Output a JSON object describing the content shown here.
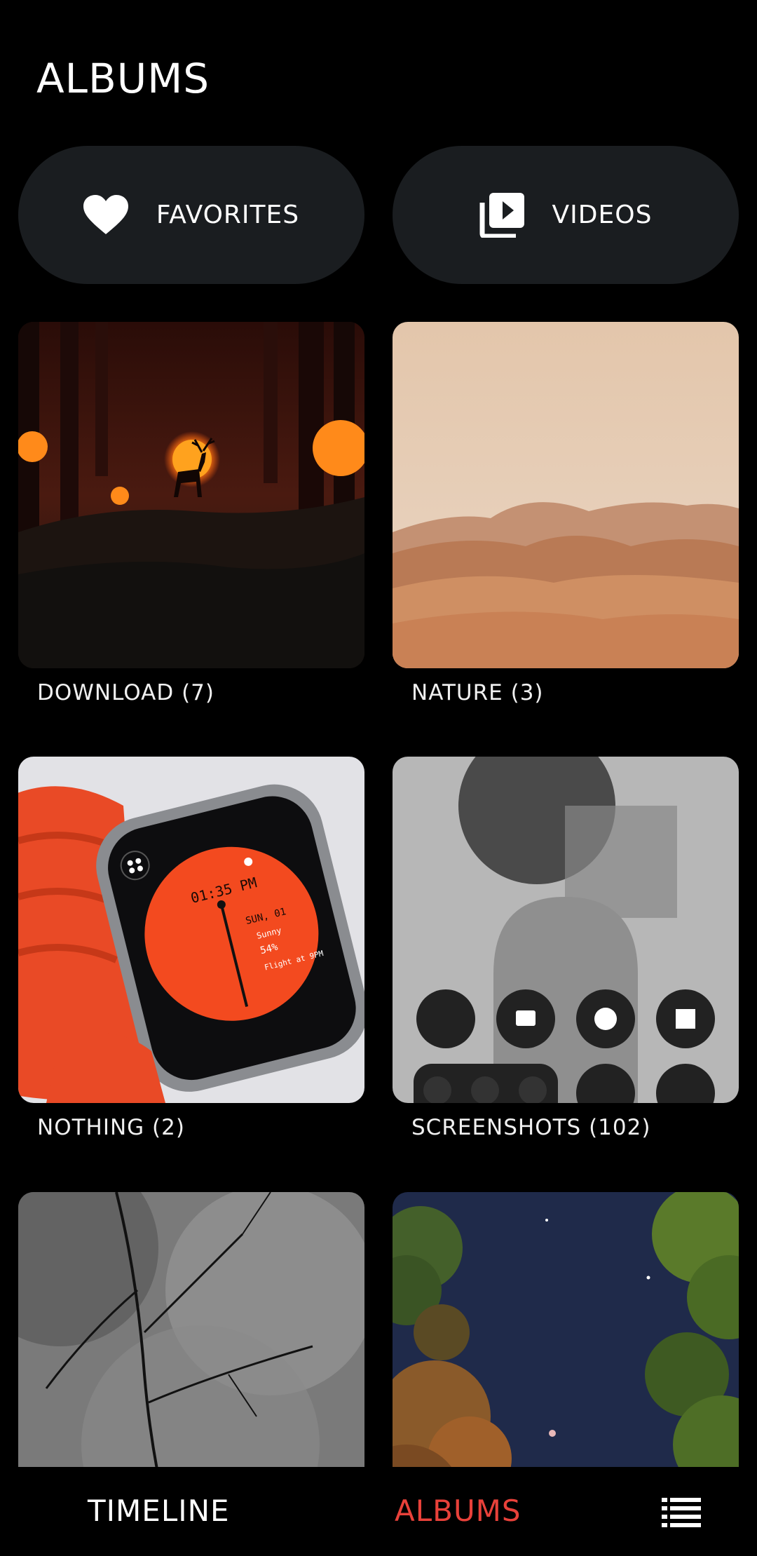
{
  "header": {
    "title": "ALBUMS"
  },
  "quick": [
    {
      "label": "FAVORITES",
      "icon": "heart-icon"
    },
    {
      "label": "VIDEOS",
      "icon": "video-library-icon"
    }
  ],
  "albums": [
    {
      "caption": "DOWNLOAD (7)"
    },
    {
      "caption": "NATURE (3)"
    },
    {
      "caption": "NOTHING (2)"
    },
    {
      "caption": "SCREENSHOTS (102)"
    },
    {
      "caption": ""
    },
    {
      "caption": ""
    }
  ],
  "watch": {
    "time": "01:35 PM",
    "date": "SUN, 01",
    "weather": "Sunny",
    "battery": "54%",
    "event": "Flight at 9PM"
  },
  "nav": {
    "tabs": [
      {
        "label": "TIMELINE"
      },
      {
        "label": "ALBUMS",
        "active": true
      }
    ],
    "menu_icon": "list-menu-icon"
  },
  "colors": {
    "accent": "#e8413a",
    "pill_bg": "#1a1d20",
    "background": "#000000"
  }
}
